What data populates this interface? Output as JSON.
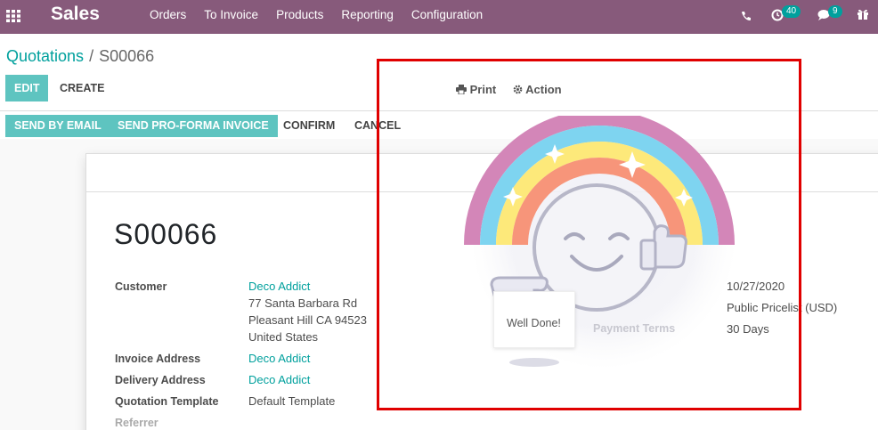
{
  "navbar": {
    "brand": "Sales",
    "menu": [
      "Orders",
      "To Invoice",
      "Products",
      "Reporting",
      "Configuration"
    ],
    "activity_count": "40",
    "message_count": "9",
    "icons": [
      "apps-grid-icon",
      "phone-icon",
      "clock-icon",
      "chat-icon",
      "gift-icon"
    ]
  },
  "breadcrumb": {
    "parent": "Quotations",
    "separator": "/",
    "current": "S00066"
  },
  "buttons": {
    "edit": "EDIT",
    "create": "CREATE",
    "print": "Print",
    "action": "Action",
    "send_email": "SEND BY EMAIL",
    "send_proforma": "SEND PRO-FORMA INVOICE",
    "confirm": "CONFIRM",
    "cancel": "CANCEL"
  },
  "form": {
    "title": "S00066",
    "customer_label": "Customer",
    "customer_name": "Deco Addict",
    "address_line1": "77 Santa Barbara Rd",
    "address_line2": "Pleasant Hill CA 94523",
    "address_line3": "United States",
    "invoice_address_label": "Invoice Address",
    "invoice_address": "Deco Addict",
    "delivery_address_label": "Delivery Address",
    "delivery_address": "Deco Addict",
    "template_label": "Quotation Template",
    "template_value": "Default Template",
    "referrer_label": "Referrer",
    "date_value": "10/27/2020",
    "pricelist_value": "Public Pricelist (USD)",
    "payment_terms_label": "Payment Terms",
    "payment_terms_value": "30 Days"
  },
  "overlay": {
    "well_done": "Well Done!"
  },
  "colors": {
    "navbar": "#875a7b",
    "accent": "#00a09d",
    "primary_button": "#5ec4c0",
    "highlight_border": "#e00000"
  }
}
